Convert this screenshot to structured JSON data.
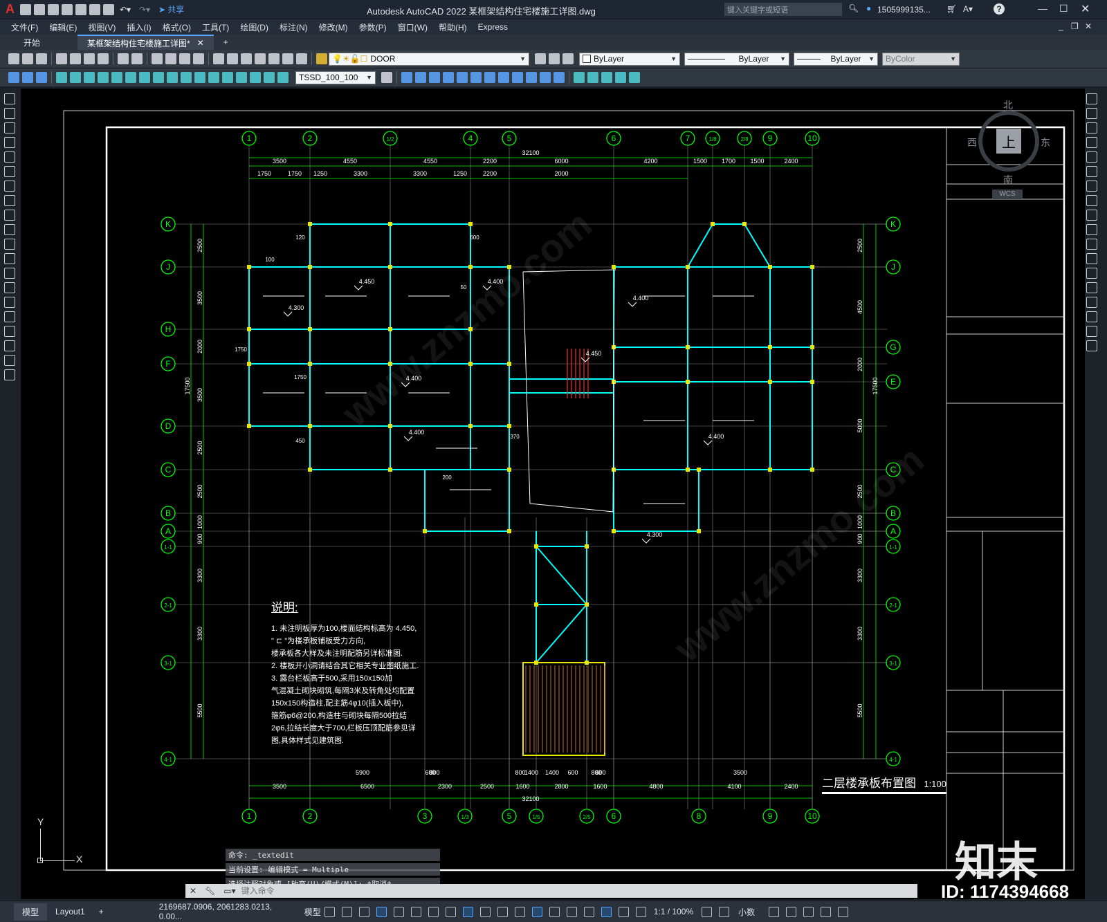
{
  "titlebar": {
    "logo": "A",
    "share_label": "共享",
    "title": "Autodesk AutoCAD 2022    某框架结构住宅楼施工详图.dwg",
    "search_placeholder": "键入关键字或短语",
    "user": "1505999135...",
    "help": "?"
  },
  "menu": [
    "文件(F)",
    "编辑(E)",
    "视图(V)",
    "插入(I)",
    "格式(O)",
    "工具(T)",
    "绘图(D)",
    "标注(N)",
    "修改(M)",
    "参数(P)",
    "窗口(W)",
    "帮助(H)",
    "Express"
  ],
  "tabs": {
    "start": "开始",
    "drawing": "某框架结构住宅楼施工详图*",
    "add": "+"
  },
  "toolbar": {
    "layer_value": "DOOR",
    "color_value": "ByLayer",
    "linetype_value": "ByLayer",
    "lineweight_value": "ByLayer",
    "plotstyle_value": "ByColor",
    "dimstyle_value": "TSSD_100_100"
  },
  "viewcube": {
    "north": "北",
    "south": "南",
    "east": "东",
    "west": "西",
    "top": "上",
    "wcs": "WCS"
  },
  "drawing": {
    "title": "二层楼承板布置图",
    "scale": "1:100",
    "notes_title": "说明:",
    "notes": [
      "1. 未注明板厚为100,楼面结构标高为 4.450,",
      "\"  ⊏ \"为楼承板铺板受力方向,",
      "楼承板各大样及未注明配筋另详标准图.",
      "2. 楼板开小洞请结合其它相关专业图纸施工.",
      "3. 露台栏板高于500,采用150x150加",
      "气混凝土砌块砌筑,每隔3米及转角处均配置",
      "150x150构造柱,配主筋4φ10(插入板中),",
      "箍筋φ6@200,构造柱与砌块每隔500拉结",
      "2φ6,拉结长度大于700,栏板压顶配筋参见详",
      "图,具体样式见建筑图."
    ],
    "axes_top": [
      "1",
      "2",
      "1/2",
      "4",
      "5",
      "6",
      "7",
      "1/8",
      "2/8",
      "9",
      "10"
    ],
    "axes_bottom": [
      "1",
      "2",
      "3",
      "1/3",
      "5",
      "1/5",
      "2/5",
      "6",
      "8",
      "9",
      "10"
    ],
    "axes_left": [
      "K",
      "J",
      "H",
      "F",
      "D",
      "C",
      "B",
      "A",
      "1-1",
      "2-1",
      "3-1",
      "4-1"
    ],
    "axes_right": [
      "K",
      "J",
      "G",
      "E",
      "C",
      "B",
      "A",
      "1-1",
      "2-1",
      "3-1",
      "4-1"
    ],
    "dims_top_total": "32100",
    "dims_top_row1": [
      "3500",
      "4550",
      "4550",
      "2200",
      "6000",
      "4200",
      "1500",
      "1700",
      "1500",
      "2400"
    ],
    "dims_top_row2": [
      "1750",
      "1750",
      "1250",
      "3300",
      "3300",
      "1250",
      "2200",
      "2000"
    ],
    "dims_bottom_total": "32100",
    "dims_bottom_row1": [
      "3500",
      "6500",
      "2300",
      "2500",
      "1600",
      "2800",
      "1600",
      "4800",
      "4100",
      "2400"
    ],
    "dims_bottom_row2": [
      "5900",
      "600",
      "800",
      "800",
      "1400",
      "1400",
      "600",
      "800",
      "600",
      "3500"
    ],
    "dims_left": [
      "2500",
      "3500",
      "2000",
      "3500",
      "2500",
      "2500",
      "1000",
      "900",
      "3300",
      "3300",
      "5500"
    ],
    "dims_left_total": "17500",
    "dims_right": [
      "2500",
      "4500",
      "2000",
      "5000",
      "2500",
      "1000",
      "900",
      "3300",
      "3300",
      "5500"
    ],
    "dims_right_total": "17500",
    "elevations": [
      "4.450",
      "4.300",
      "4.400",
      "4.400",
      "4.400",
      "4.450",
      "4.400",
      "4.400",
      "4.300"
    ],
    "labels_small": [
      "100",
      "120",
      "600",
      "1750",
      "1750",
      "450",
      "50",
      "370",
      "200"
    ]
  },
  "command": {
    "history": [
      "命令: _textedit",
      "当前设置: 编辑模式 = Multiple",
      "选择注释对象或 [放弃(U)/模式(M)]: *取消*"
    ],
    "placeholder": "键入命令"
  },
  "layout_tabs": {
    "model": "模型",
    "layout1": "Layout1",
    "add": "+"
  },
  "status": {
    "coords": "2169687.0906, 2061283.0213, 0.00...",
    "mode": "模型",
    "scale": "1:1 / 100%",
    "units": "小数"
  },
  "watermark": {
    "brand": "知末",
    "id": "ID: 1174394668",
    "url": "www.znzmo.com"
  },
  "ucs": {
    "x": "X",
    "y": "Y"
  },
  "colors": {
    "grid_axis": "#00ff00",
    "beam": "#00ffff",
    "frame": "#ffffff",
    "dim": "#00ff00",
    "text": "#ffffff"
  }
}
